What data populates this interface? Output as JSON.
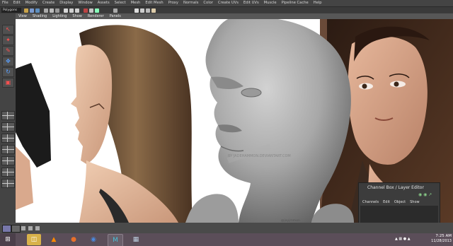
{
  "menubar": {
    "items": [
      "File",
      "Edit",
      "Modify",
      "Create",
      "Display",
      "Window",
      "Assets",
      "Select",
      "Mesh",
      "Edit Mesh",
      "Proxy",
      "Normals",
      "Color",
      "Create UVs",
      "Edit UVs",
      "Muscle",
      "Pipeline Cache",
      "Help"
    ]
  },
  "statusline": {
    "selection_mode": "Polygons"
  },
  "panel_menu": {
    "items": [
      "View",
      "Shading",
      "Lighting",
      "Show",
      "Renderer",
      "Panels"
    ]
  },
  "viewport": {
    "watermark_center": "BY JADEHAMMON.DEVIANTART.COM",
    "watermark_bottom": "@jayjmmon"
  },
  "channel_box": {
    "title": "Channel Box / Layer Editor",
    "menu": [
      "Channels",
      "Edit",
      "Object",
      "Show"
    ]
  },
  "taskbar": {
    "time": "7:25 AM",
    "date": "11/28/2013",
    "apps": [
      "file-explorer-icon",
      "vlc-icon",
      "firefox-icon",
      "chrome-icon",
      "maya-icon",
      "clipboard-icon"
    ]
  },
  "colors": {
    "menubar_bg": "#444444",
    "viewport_bg": "#ffffff",
    "taskbar_bg": "#5b4e59",
    "panel_menu_bg": "#575757"
  }
}
